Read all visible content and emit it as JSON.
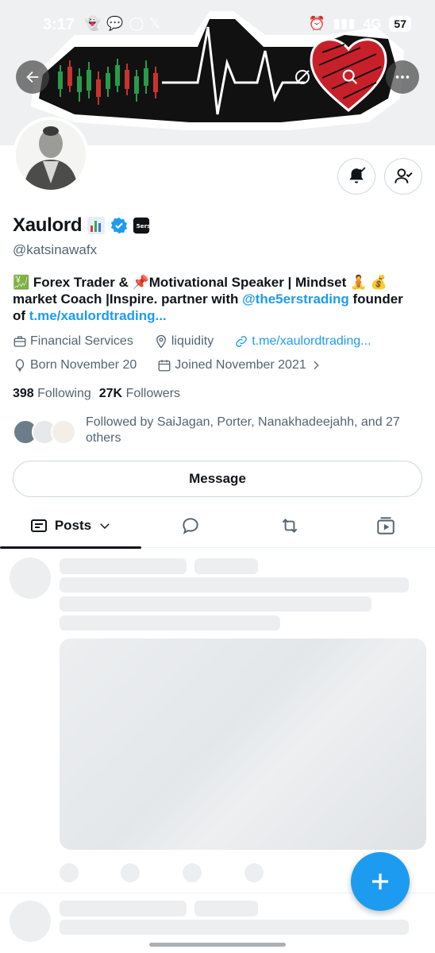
{
  "status_bar": {
    "time": "3:17",
    "network": "4G",
    "battery": "57"
  },
  "profile": {
    "display_name": "Xaulord",
    "handle": "@katsinawafx",
    "bio_part1": "💹 Forex Trader & 📌Motivational Speaker | Mindset 🧘 💰 market Coach |Inspire. partner with ",
    "bio_mention": "@the5erstrading",
    "bio_part2": " founder of ",
    "bio_link": "t.me/xaulordtrading...",
    "category": "Financial Services",
    "location": "liquidity",
    "website": "t.me/xaulordtrading...",
    "born": "Born November 20",
    "joined": "Joined November 2021",
    "following_count": "398",
    "following_label": "Following",
    "followers_count": "27K",
    "followers_label": "Followers",
    "followed_by": "Followed by SaiJagan, Porter, Nanakhadeejahh, and 27 others"
  },
  "buttons": {
    "message": "Message"
  },
  "tabs": [
    {
      "label": "Posts",
      "icon": "posts-icon"
    },
    {
      "label": "",
      "icon": "replies-icon"
    },
    {
      "label": "",
      "icon": "reposts-icon"
    },
    {
      "label": "",
      "icon": "media-icon"
    }
  ],
  "colors": {
    "accent": "#1d9bf0",
    "text": "#0f1419",
    "secondary": "#536471"
  },
  "icons": [
    "back-icon",
    "grok-icon",
    "search-icon",
    "more-icon",
    "bell-icon",
    "follow-icon",
    "verified-icon",
    "briefcase-icon",
    "location-icon",
    "link-icon",
    "balloon-icon",
    "calendar-icon",
    "plus-icon"
  ]
}
